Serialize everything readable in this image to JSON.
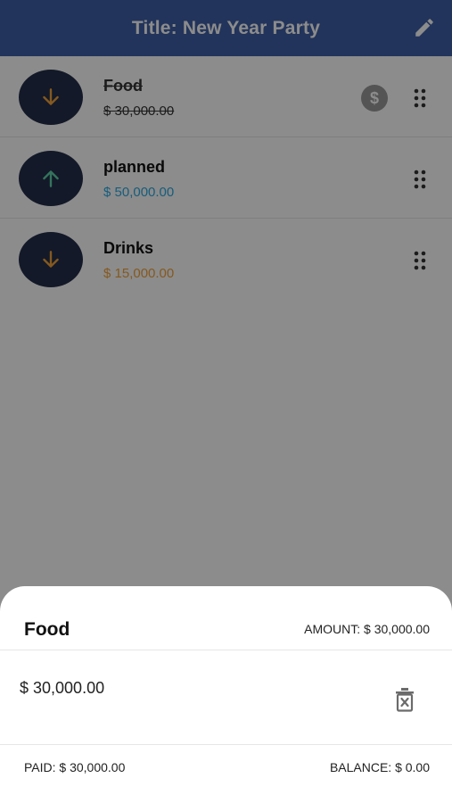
{
  "app_bar": {
    "title": "Title: New Year Party",
    "edit_icon": "pencil-icon"
  },
  "items": [
    {
      "title": "Food",
      "amount": "$ 30,000.00",
      "direction": "down",
      "completed": true,
      "amount_color": "#333333",
      "arrow_color": "#f2a23a"
    },
    {
      "title": "planned",
      "amount": "$ 50,000.00",
      "direction": "up",
      "completed": false,
      "amount_color": "#2aa9e0",
      "arrow_color": "#5fd3a8"
    },
    {
      "title": "Drinks",
      "amount": "$ 15,000.00",
      "direction": "down",
      "completed": false,
      "amount_color": "#f2a23a",
      "arrow_color": "#f2a23a"
    }
  ],
  "sheet": {
    "title": "Food",
    "amount_label": "AMOUNT: $ 30,000.00",
    "value": "$ 30,000.00",
    "paid_label": "PAID: $ 30,000.00",
    "balance_label": "BALANCE: $ 0.00"
  },
  "colors": {
    "app_bar": "#3f5fa6",
    "avatar": "#232f4a",
    "scrim": "rgba(0,0,0,0.45)"
  }
}
